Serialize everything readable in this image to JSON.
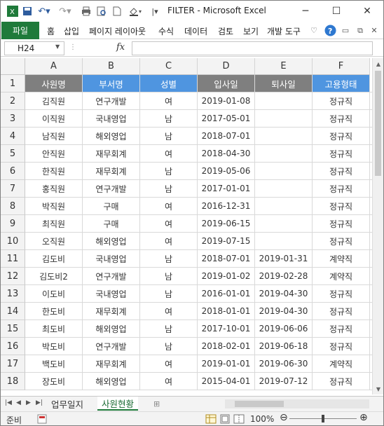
{
  "window": {
    "title": "FILTER  -  Microsoft Excel",
    "controls": [
      "─",
      "☐",
      "✕"
    ]
  },
  "ribbon": {
    "file_tab": "파일",
    "tabs": [
      "홈",
      "삽입",
      "페이지 레이아웃",
      "수식",
      "데이터",
      "검토",
      "보기",
      "개발 도구"
    ]
  },
  "formula_bar": {
    "name_box": "H24",
    "fx_label": "fx",
    "formula_value": ""
  },
  "sheet": {
    "columns": [
      "A",
      "B",
      "C",
      "D",
      "E",
      "F"
    ],
    "header_row": [
      "사원명",
      "부서명",
      "성별",
      "입사일",
      "퇴사일",
      "고용형태"
    ],
    "rows": [
      [
        "김직원",
        "연구개발",
        "여",
        "2019-01-08",
        "",
        "정규직"
      ],
      [
        "이직원",
        "국내영업",
        "남",
        "2017-05-01",
        "",
        "정규직"
      ],
      [
        "남직원",
        "해외영업",
        "남",
        "2018-07-01",
        "",
        "정규직"
      ],
      [
        "안직원",
        "재무회계",
        "여",
        "2018-04-30",
        "",
        "정규직"
      ],
      [
        "한직원",
        "재무회계",
        "남",
        "2019-05-06",
        "",
        "정규직"
      ],
      [
        "홍직원",
        "연구개발",
        "남",
        "2017-01-01",
        "",
        "정규직"
      ],
      [
        "박직원",
        "구매",
        "여",
        "2016-12-31",
        "",
        "정규직"
      ],
      [
        "최직원",
        "구매",
        "여",
        "2019-06-15",
        "",
        "정규직"
      ],
      [
        "오직원",
        "해외영업",
        "여",
        "2019-07-15",
        "",
        "정규직"
      ],
      [
        "김도비",
        "국내영업",
        "남",
        "2018-07-01",
        "2019-01-31",
        "계약직"
      ],
      [
        "김도비2",
        "연구개발",
        "남",
        "2019-01-02",
        "2019-02-28",
        "계약직"
      ],
      [
        "이도비",
        "국내영업",
        "남",
        "2016-01-01",
        "2019-04-30",
        "정규직"
      ],
      [
        "한도비",
        "재무회계",
        "여",
        "2018-01-01",
        "2019-04-30",
        "정규직"
      ],
      [
        "최도비",
        "해외영업",
        "남",
        "2017-10-01",
        "2019-06-06",
        "정규직"
      ],
      [
        "박도비",
        "연구개발",
        "남",
        "2018-02-01",
        "2019-06-18",
        "정규직"
      ],
      [
        "백도비",
        "재무회계",
        "여",
        "2019-01-01",
        "2019-06-30",
        "계약직"
      ],
      [
        "장도비",
        "해외영업",
        "여",
        "2015-04-01",
        "2019-07-12",
        "정규직"
      ]
    ],
    "row_numbers": [
      "1",
      "2",
      "3",
      "4",
      "5",
      "6",
      "7",
      "8",
      "9",
      "10",
      "11",
      "12",
      "13",
      "14",
      "15",
      "16",
      "17",
      "18"
    ]
  },
  "sheet_tabs": {
    "tabs": [
      "업무일지",
      "사원현황"
    ],
    "active": "사원현황"
  },
  "status_bar": {
    "mode": "준비",
    "zoom": "100%"
  },
  "colors": {
    "file_tab": "#1f7a3a",
    "header_gray": "#7f7f7f",
    "header_blue": "#4f95e0"
  }
}
